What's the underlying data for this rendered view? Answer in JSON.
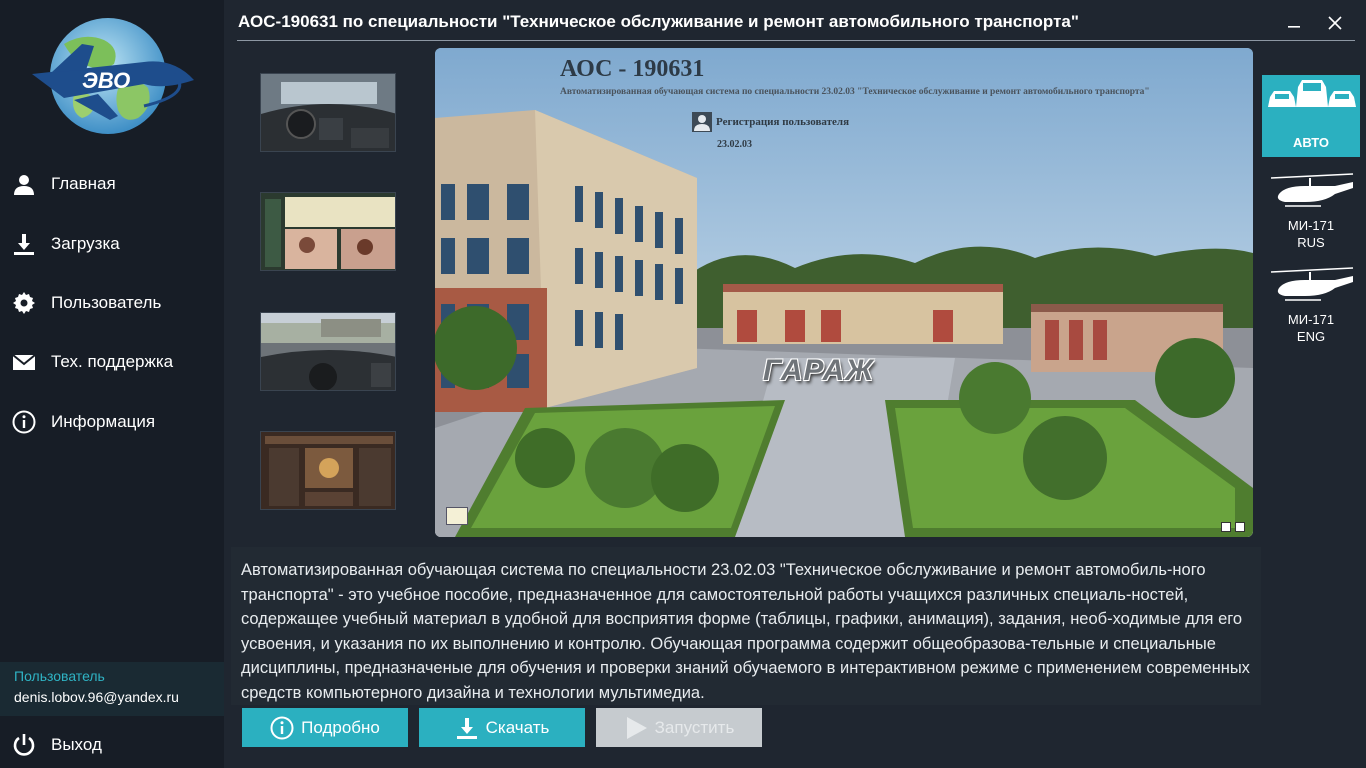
{
  "window": {
    "title": "АОС-190631 по специальности \"Техническое обслуживание и ремонт автомобильного транспорта\""
  },
  "sidebar": {
    "logo_text": "ЭВО",
    "items": [
      {
        "label": "Главная",
        "icon": "user-icon"
      },
      {
        "label": "Загрузка",
        "icon": "download-icon"
      },
      {
        "label": "Пользователь",
        "icon": "gear-icon"
      },
      {
        "label": "Тех. поддержка",
        "icon": "mail-icon"
      },
      {
        "label": "Информация",
        "icon": "info-icon"
      }
    ],
    "user": {
      "label": "Пользователь",
      "email": "denis.lobov.96@yandex.ru"
    },
    "logout_label": "Выход"
  },
  "preview": {
    "title": "АОС - 190631",
    "subtitle": "Автоматизированная обучающая система по специальности 23.02.03 \"Техническое обслуживание и ремонт автомобильного транспорта\"",
    "register_label": "Регистрация пользователя",
    "code": "23.02.03",
    "garage_label": "ГАРАЖ"
  },
  "categories": [
    {
      "label": "АВТО",
      "selected": true
    },
    {
      "label": "МИ-171",
      "sub": "RUS",
      "selected": false
    },
    {
      "label": "МИ-171",
      "sub": "ENG",
      "selected": false
    }
  ],
  "description": "Автоматизированная обучающая система по специальности 23.02.03 \"Техническое обслуживание и ремонт автомобиль-ного транспорта\" - это учебное пособие, предназначенное для самостоятельной работы учащихся различных специаль-ностей, содержащее учебный материал в удобной для восприятия форме (таблицы, графики, анимация), задания, необ-ходимые для его усвоения, и указания по их выполнению и контролю. Обучающая программа содержит общеобразова-тельные и специальные дисциплины, предназначеные для обучения и проверки знаний обучаемого в интерактивном режиме с применением современных средств компьютерного дизайна и технологии мультимедиа.",
  "actions": {
    "details_label": "Подробно",
    "download_label": "Скачать",
    "run_label": "Запустить"
  },
  "colors": {
    "accent": "#2bb0c0",
    "disabled": "#c6cbcf",
    "sidebar_bg": "#171d26",
    "main_bg": "#1f2630"
  }
}
